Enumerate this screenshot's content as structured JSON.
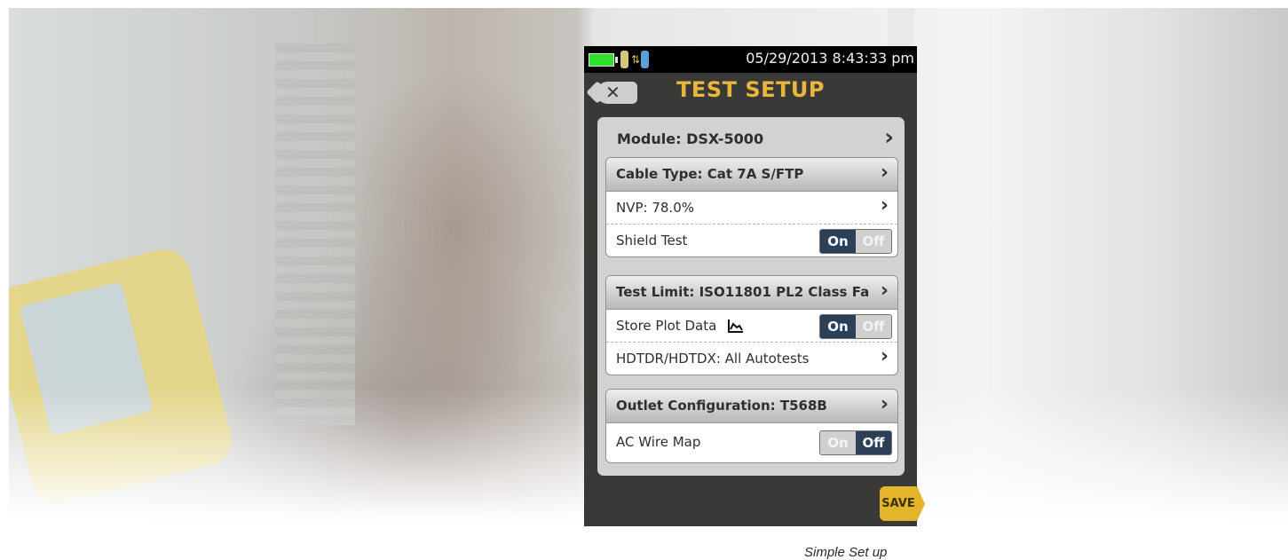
{
  "status_bar": {
    "battery_color": "#2ee02a",
    "remote_icon": "remote-connection-icon",
    "datetime": "05/29/2013 8:43:33 pm"
  },
  "title_bar": {
    "back_icon": "close-x-icon",
    "title": "TEST SETUP"
  },
  "module": {
    "label": "Module: DSX-5000"
  },
  "cable_group": {
    "header": "Cable Type: Cat 7A S/FTP",
    "nvp": "NVP: 78.0%",
    "shield_test": {
      "label": "Shield Test",
      "on": "On",
      "off": "Off",
      "selected": "On"
    }
  },
  "limit_group": {
    "header": "Test Limit: ISO11801 PL2 Class Fa",
    "store_plot": {
      "label": "Store Plot Data",
      "icon": "plot-data-icon",
      "on": "On",
      "off": "Off",
      "selected": "On"
    },
    "hdtdr": "HDTDR/HDTDX: All Autotests"
  },
  "outlet_group": {
    "header": "Outlet Configuration: T568B",
    "ac_wire_map": {
      "label": "AC Wire Map",
      "on": "On",
      "off": "Off",
      "selected": "Off"
    }
  },
  "chevron": "›",
  "save_label": "SAVE",
  "caption": "Simple Set up",
  "colors": {
    "accent": "#e9b73c",
    "toggle_selected": "#2b3f57",
    "save": "#e4b42c"
  }
}
